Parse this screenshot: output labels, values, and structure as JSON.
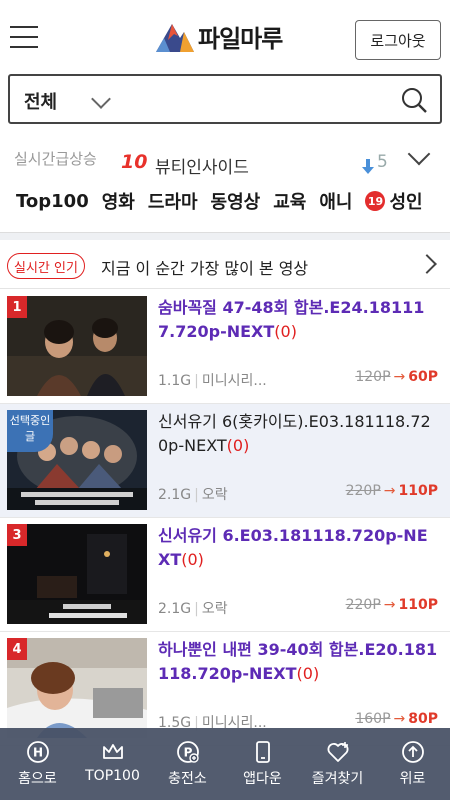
{
  "header": {
    "logo_text": "파일마루",
    "logout_label": "로그아웃"
  },
  "search": {
    "category": "전체",
    "placeholder": ""
  },
  "trending": {
    "label": "실시간급상승",
    "rank": "10",
    "keyword": "뷰티인사이드",
    "change": "5"
  },
  "categories": [
    "Top100",
    "영화",
    "드라마",
    "동영상",
    "교육",
    "애니",
    "성인"
  ],
  "adult_badge": "19",
  "popular": {
    "tag": "실시간 인기",
    "text": "지금 이 순간 가장 많이 본 영상"
  },
  "items": [
    {
      "rank": "1",
      "title": "숨바꼭질 47-48회 합본.E24.181117.720p-NEXT",
      "count": "(0)",
      "size": "1.1G",
      "genre": "미니시리...",
      "old_price": "120P",
      "new_price": "60P"
    },
    {
      "rank": "2",
      "selected_label": "선택중인 글",
      "title": "신서유기 6(홋카이도).E03.181118.720p-NEXT",
      "count": "(0)",
      "size": "2.1G",
      "genre": "오락",
      "old_price": "220P",
      "new_price": "110P"
    },
    {
      "rank": "3",
      "title": "신서유기 6.E03.181118.720p-NEXT",
      "count": "(0)",
      "size": "2.1G",
      "genre": "오락",
      "old_price": "220P",
      "new_price": "110P"
    },
    {
      "rank": "4",
      "title": "하나뿐인 내편 39-40회 합본.E20.181118.720p-NEXT",
      "count": "(0)",
      "size": "1.5G",
      "genre": "미니시리...",
      "old_price": "160P",
      "new_price": "80P"
    }
  ],
  "bottom_nav": [
    {
      "label": "홈으로",
      "icon": "home-icon"
    },
    {
      "label": "TOP100",
      "icon": "crown-icon"
    },
    {
      "label": "충전소",
      "icon": "charge-icon"
    },
    {
      "label": "앱다운",
      "icon": "phone-icon"
    },
    {
      "label": "즐겨찾기",
      "icon": "heart-plus-icon"
    },
    {
      "label": "위로",
      "icon": "up-arrow-icon"
    }
  ],
  "colors": {
    "accent_red": "#e02020",
    "hot_title": "#5d2bb5",
    "nav_bg": "#465064",
    "selected_bg": "#eef1f8"
  }
}
